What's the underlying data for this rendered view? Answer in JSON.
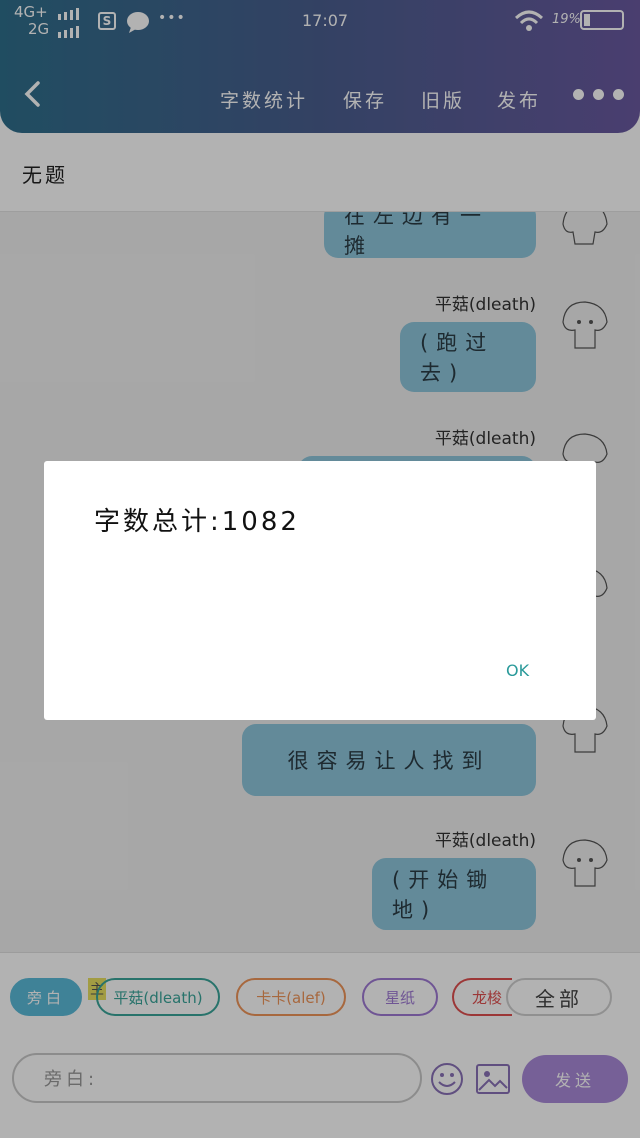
{
  "status": {
    "net1": "4G+",
    "net2": "2G",
    "sim_icon": "S",
    "more": "•••",
    "time": "17:07",
    "battery_text": "19%"
  },
  "toolbar": {
    "word_count": "字数统计",
    "save": "保存",
    "old_version": "旧版",
    "publish": "发布"
  },
  "page": {
    "title": "无题"
  },
  "chat": [
    {
      "bubble": "在左边有一摊"
    },
    {
      "speaker": "平菇(dleath)",
      "bubble": "(跑过去)"
    },
    {
      "speaker": "平菇(dleath)"
    },
    {
      "bubble": "很容易让人找到"
    },
    {
      "speaker": "平菇(dleath)",
      "bubble": "(开始锄地)"
    }
  ],
  "roles": {
    "narration": "旁白",
    "main_tag": "主",
    "role1": "平菇(dleath)",
    "role2": "卡卡(alef)",
    "role3": "星纸",
    "role4": "龙梭",
    "all": "全部"
  },
  "input": {
    "placeholder": "旁白:"
  },
  "send": "发送",
  "dialog": {
    "message": "字数总计:1082",
    "ok": "OK"
  },
  "colors": {
    "bubble": "#8fc6dc",
    "chip_narration": "#5bbad8",
    "chip_role1": "#3aa59a",
    "chip_role2": "#f0955a",
    "chip_role3": "#9f7ad4",
    "chip_role4": "#e05050",
    "send": "#a98ad9"
  }
}
